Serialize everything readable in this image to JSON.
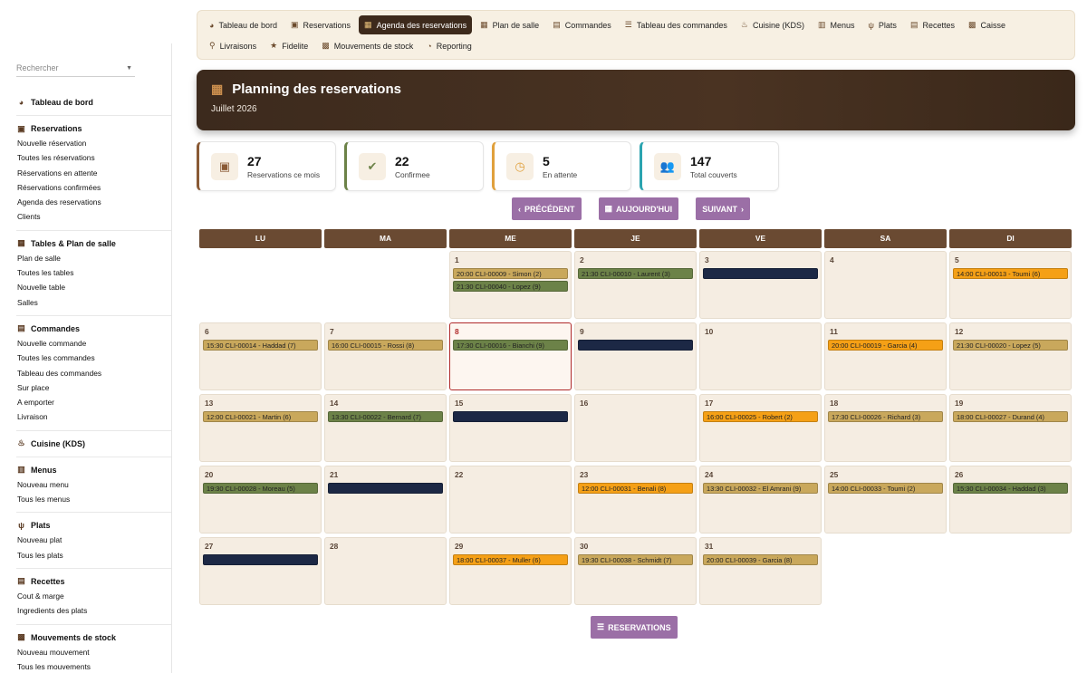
{
  "sidebar": {
    "search_placeholder": "Rechercher",
    "sections": [
      {
        "title": "Tableau de bord",
        "icon": "dashboard-icon",
        "items": []
      },
      {
        "title": "Reservations",
        "icon": "calendar-check-icon",
        "items": [
          "Nouvelle réservation",
          "Toutes les réservations",
          "Réservations en attente",
          "Réservations confirmées",
          "Agenda des reservations",
          "Clients"
        ]
      },
      {
        "title": "Tables & Plan de salle",
        "icon": "grid-icon",
        "items": [
          "Plan de salle",
          "Toutes les tables",
          "Nouvelle table",
          "Salles"
        ]
      },
      {
        "title": "Commandes",
        "icon": "receipt-icon",
        "items": [
          "Nouvelle commande",
          "Toutes les commandes",
          "Tableau des commandes",
          "Sur place",
          "A emporter",
          "Livraison"
        ]
      },
      {
        "title": "Cuisine (KDS)",
        "icon": "flame-icon",
        "items": []
      },
      {
        "title": "Menus",
        "icon": "book-icon",
        "items": [
          "Nouveau menu",
          "Tous les menus"
        ]
      },
      {
        "title": "Plats",
        "icon": "utensils-icon",
        "items": [
          "Nouveau plat",
          "Tous les plats"
        ]
      },
      {
        "title": "Recettes",
        "icon": "recipe-icon",
        "items": [
          "Cout & marge",
          "Ingredients des plats"
        ]
      },
      {
        "title": "Mouvements de stock",
        "icon": "boxes-icon",
        "items": [
          "Nouveau mouvement",
          "Tous les mouvements"
        ]
      }
    ]
  },
  "topnav": {
    "row1": [
      {
        "label": "Tableau de bord",
        "icon": "dashboard-icon",
        "glyph": "◕"
      },
      {
        "label": "Reservations",
        "icon": "calendar-check-icon",
        "glyph": "▣"
      },
      {
        "label": "Agenda des reservations",
        "icon": "calendar-icon",
        "glyph": "▦",
        "active": true
      },
      {
        "label": "Plan de salle",
        "icon": "grid-icon",
        "glyph": "▦"
      },
      {
        "label": "Commandes",
        "icon": "receipt-icon",
        "glyph": "▤"
      },
      {
        "label": "Tableau des commandes",
        "icon": "list-icon",
        "glyph": "☰"
      },
      {
        "label": "Cuisine (KDS)",
        "icon": "flame-icon",
        "glyph": "♨"
      },
      {
        "label": "Menus",
        "icon": "book-icon",
        "glyph": "▥"
      },
      {
        "label": "Plats",
        "icon": "utensils-icon",
        "glyph": "ψ"
      },
      {
        "label": "Recettes",
        "icon": "recipe-icon",
        "glyph": "▤"
      },
      {
        "label": "Caisse",
        "icon": "cash-register-icon",
        "glyph": "▩"
      }
    ],
    "row2": [
      {
        "label": "Livraisons",
        "icon": "motorcycle-icon",
        "glyph": "⚲"
      },
      {
        "label": "Fidelite",
        "icon": "star-icon",
        "glyph": "★"
      },
      {
        "label": "Mouvements de stock",
        "icon": "boxes-icon",
        "glyph": "▩"
      },
      {
        "label": "Reporting",
        "icon": "pie-chart-icon",
        "glyph": "◔"
      }
    ]
  },
  "banner": {
    "title": "Planning des reservations",
    "subtitle": "Juillet 2026"
  },
  "stats": [
    {
      "value": "27",
      "label": "Reservations ce mois",
      "color": "#8a5a35",
      "icon": "calendar-check-icon",
      "glyph": "▣"
    },
    {
      "value": "22",
      "label": "Confirmee",
      "color": "#6c8248",
      "icon": "check-circle-icon",
      "glyph": "✔"
    },
    {
      "value": "5",
      "label": "En attente",
      "color": "#e0a03c",
      "icon": "clock-icon",
      "glyph": "◷"
    },
    {
      "value": "147",
      "label": "Total couverts",
      "color": "#2ba4b0",
      "icon": "users-icon",
      "glyph": "👥"
    }
  ],
  "buttons": {
    "prev": "PRÉCÉDENT",
    "today": "AUJOURD'HUI",
    "next": "SUIVANT",
    "reservations": "RESERVATIONS"
  },
  "weekdays": [
    "LU",
    "MA",
    "ME",
    "JE",
    "VE",
    "SA",
    "DI"
  ],
  "colors": {
    "tan": "#c9a85c",
    "green": "#6c8248",
    "navy": "#1c2845",
    "orange": "#f5a016",
    "accent": "#9b6fa6",
    "today_border": "#b02a2a"
  },
  "calendar": {
    "leading_blanks": 2,
    "trailing_blanks": 3,
    "today": "8",
    "days": [
      {
        "day": "1",
        "events": [
          {
            "text": "20:00 CLI-00009 - Simon (2)",
            "color": "tan"
          },
          {
            "text": "21:30 CLI-00040 - Lopez (9)",
            "color": "green"
          }
        ]
      },
      {
        "day": "2",
        "events": [
          {
            "text": "21:30 CLI-00010 - Laurent (3)",
            "color": "green"
          }
        ]
      },
      {
        "day": "3",
        "events": [
          {
            "text": "",
            "color": "navy"
          }
        ]
      },
      {
        "day": "4",
        "events": []
      },
      {
        "day": "5",
        "events": [
          {
            "text": "14:00 CLI-00013 - Toumi (6)",
            "color": "orange"
          }
        ]
      },
      {
        "day": "6",
        "events": [
          {
            "text": "15:30 CLI-00014 - Haddad (7)",
            "color": "tan"
          }
        ]
      },
      {
        "day": "7",
        "events": [
          {
            "text": "16:00 CLI-00015 - Rossi (8)",
            "color": "tan"
          }
        ]
      },
      {
        "day": "8",
        "events": [
          {
            "text": "17:30 CLI-00016 - Bianchi (9)",
            "color": "green"
          }
        ]
      },
      {
        "day": "9",
        "events": [
          {
            "text": "",
            "color": "navy"
          }
        ]
      },
      {
        "day": "10",
        "events": []
      },
      {
        "day": "11",
        "events": [
          {
            "text": "20:00 CLI-00019 - Garcia (4)",
            "color": "orange"
          }
        ]
      },
      {
        "day": "12",
        "events": [
          {
            "text": "21:30 CLI-00020 - Lopez (5)",
            "color": "tan"
          }
        ]
      },
      {
        "day": "13",
        "events": [
          {
            "text": "12:00 CLI-00021 - Martin (6)",
            "color": "tan"
          }
        ]
      },
      {
        "day": "14",
        "events": [
          {
            "text": "13:30 CLI-00022 - Bernard (7)",
            "color": "green"
          }
        ]
      },
      {
        "day": "15",
        "events": [
          {
            "text": "",
            "color": "navy"
          }
        ]
      },
      {
        "day": "16",
        "events": []
      },
      {
        "day": "17",
        "events": [
          {
            "text": "16:00 CLI-00025 - Robert (2)",
            "color": "orange"
          }
        ]
      },
      {
        "day": "18",
        "events": [
          {
            "text": "17:30 CLI-00026 - Richard (3)",
            "color": "tan"
          }
        ]
      },
      {
        "day": "19",
        "events": [
          {
            "text": "18:00 CLI-00027 - Durand (4)",
            "color": "tan"
          }
        ]
      },
      {
        "day": "20",
        "events": [
          {
            "text": "19:30 CLI-00028 - Moreau (5)",
            "color": "green"
          }
        ]
      },
      {
        "day": "21",
        "events": [
          {
            "text": "",
            "color": "navy"
          }
        ]
      },
      {
        "day": "22",
        "events": []
      },
      {
        "day": "23",
        "events": [
          {
            "text": "12:00 CLI-00031 - Benali (8)",
            "color": "orange"
          }
        ]
      },
      {
        "day": "24",
        "events": [
          {
            "text": "13:30 CLI-00032 - El Amrani (9)",
            "color": "tan"
          }
        ]
      },
      {
        "day": "25",
        "events": [
          {
            "text": "14:00 CLI-00033 - Toumi (2)",
            "color": "tan"
          }
        ]
      },
      {
        "day": "26",
        "events": [
          {
            "text": "15:30 CLI-00034 - Haddad (3)",
            "color": "green"
          }
        ]
      },
      {
        "day": "27",
        "events": [
          {
            "text": "",
            "color": "navy"
          }
        ]
      },
      {
        "day": "28",
        "events": []
      },
      {
        "day": "29",
        "events": [
          {
            "text": "18:00 CLI-00037 - Muller (6)",
            "color": "orange"
          }
        ]
      },
      {
        "day": "30",
        "events": [
          {
            "text": "19:30 CLI-00038 - Schmidt (7)",
            "color": "tan"
          }
        ]
      },
      {
        "day": "31",
        "events": [
          {
            "text": "20:00 CLI-00039 - Garcia (8)",
            "color": "tan"
          }
        ]
      }
    ]
  }
}
